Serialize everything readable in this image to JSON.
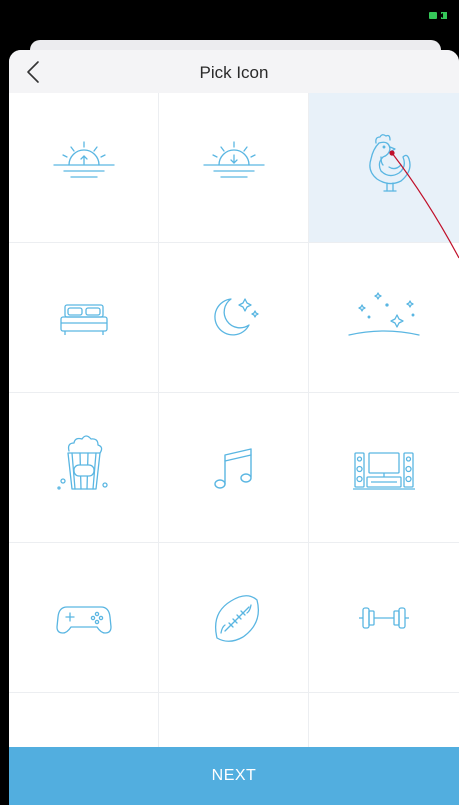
{
  "header": {
    "title": "Pick Icon",
    "back_icon": "chevron-left-icon"
  },
  "icons": [
    {
      "name": "sunrise-icon",
      "selected": false
    },
    {
      "name": "sunset-icon",
      "selected": false
    },
    {
      "name": "rooster-icon",
      "selected": true
    },
    {
      "name": "bed-icon",
      "selected": false
    },
    {
      "name": "moon-stars-icon",
      "selected": false
    },
    {
      "name": "starry-night-icon",
      "selected": false
    },
    {
      "name": "popcorn-icon",
      "selected": false
    },
    {
      "name": "music-note-icon",
      "selected": false
    },
    {
      "name": "home-theater-icon",
      "selected": false
    },
    {
      "name": "gamepad-icon",
      "selected": false
    },
    {
      "name": "football-icon",
      "selected": false
    },
    {
      "name": "dumbbell-icon",
      "selected": false
    }
  ],
  "next_button": {
    "label": "NEXT"
  },
  "colors": {
    "accent": "#52aedf",
    "icon_stroke": "#5ab6e2",
    "selected_bg": "#e8f1f9",
    "battery": "#35c759"
  }
}
